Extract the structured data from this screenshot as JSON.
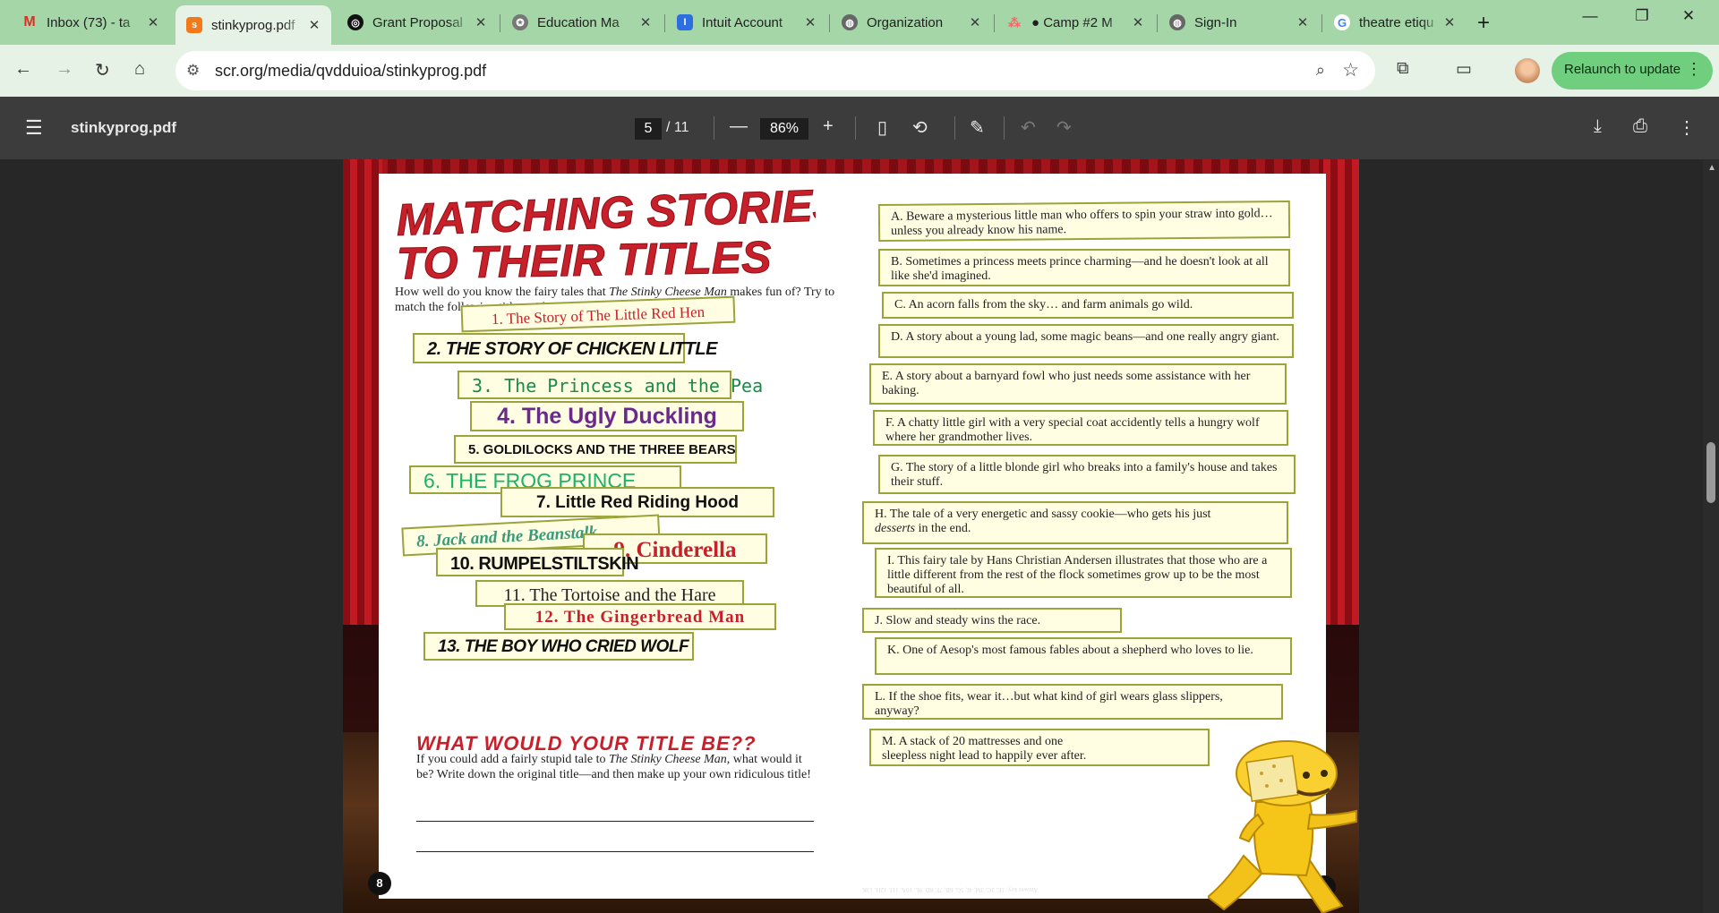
{
  "browser": {
    "tabs": [
      {
        "title": "Inbox (73) - ta",
        "icon": "gmail-icon",
        "color": "#d93025"
      },
      {
        "title": "stinkyprog.pdf",
        "icon": "pdf-site-icon",
        "color": "#f27a1a",
        "active": true
      },
      {
        "title": "Grant Proposal",
        "icon": "openai-icon",
        "color": "#111111"
      },
      {
        "title": "Education Ma",
        "icon": "seal-icon",
        "color": "#666666"
      },
      {
        "title": "Intuit Account",
        "icon": "intuit-icon",
        "color": "#2d6fe0"
      },
      {
        "title": "Organization",
        "icon": "globe-icon",
        "color": "#555555"
      },
      {
        "title": "● Camp #2 M",
        "icon": "asana-icon",
        "color": "#f06a6a"
      },
      {
        "title": "Sign-In",
        "icon": "globe-icon",
        "color": "#555555"
      },
      {
        "title": "theatre etiqu",
        "icon": "google-icon",
        "color": "#4285f4"
      }
    ],
    "url": "scr.org/media/qvdduioa/stinkyprog.pdf",
    "relaunch_label": "Relaunch to update"
  },
  "pdf": {
    "filename": "stinkyprog.pdf",
    "current_page": "5",
    "total_pages": "/ 11",
    "zoom": "86%"
  },
  "page_left": {
    "title_line1": "MATCHING STORIES",
    "title_line2": "TO THEIR TITLES",
    "intro_a": "How well do you know the fairy tales that ",
    "intro_book": "The Stinky Cheese Man",
    "intro_b": " makes fun of? Try to match the following titles with their description:",
    "titles": [
      "1. The Story of The Little Red Hen",
      "2. THE STORY OF CHICKEN LITTLE",
      "3. The Princess and the Pea",
      "4. The Ugly Duckling",
      "5. GOLDILOCKS AND THE THREE BEARS",
      "6. THE FROG PRINCE",
      "7. Little Red Riding Hood",
      "8. Jack and the Beanstalk",
      "9. Cinderella",
      "10. RUMPELSTILTSKIN",
      "11. The Tortoise and the Hare",
      "12. The Gingerbread Man",
      "13. THE BOY WHO CRIED WOLF"
    ],
    "subhead": "WHAT WOULD YOUR TITLE BE??",
    "sub_a": "If you could add a fairly stupid tale to ",
    "sub_book": "The Stinky Cheese Man",
    "sub_b": ", what would it be? Write down the original title—and then make up your own ridiculous title!",
    "page_number": "8"
  },
  "page_right": {
    "descriptions": [
      "A. Beware a mysterious little man who offers to spin your straw into gold…unless you already know his name.",
      "B. Sometimes a princess meets prince charming—and he doesn't look at all like she'd imagined.",
      "C. An acorn falls from the sky… and farm animals go wild.",
      "D. A story about a young lad, some magic beans—and one really angry giant.",
      "E. A story about a barnyard fowl who just needs some assistance with her baking.",
      "F. A chatty little girl with a very special coat accidently tells a hungry wolf where her grandmother lives.",
      "G. The story of a little blonde girl who breaks into a family's house and takes their stuff.",
      "H. The tale of a very energetic and sassy cookie—who gets his just",
      "I. This fairy tale by Hans Christian Andersen illustrates that those who are a little different from the rest of the flock sometimes grow up to be the most beautiful of all.",
      "J. Slow and steady wins the race.",
      "K. One of Aesop's most famous fables about a shepherd who loves to lie.",
      "L. If the shoe fits, wear it…but what kind of girl wears glass slippers, anyway?",
      "M. A stack of 20 mattresses and one sleepless night lead to happily ever after."
    ],
    "h_italic": "desserts",
    "h_tail": " in the end.",
    "answer_key": "Answer key: 1E, 2C, 3M, 4I, 5G, 6B, 7F, 8D, 9L, 10A, 11J, 12H, 13K",
    "page_number": "9"
  },
  "icons": {
    "back": "arrow-left-icon",
    "forward": "arrow-right-icon",
    "reload": "reload-icon",
    "home": "home-icon",
    "menu": "hamburger-icon",
    "download": "download-icon",
    "print": "print-icon"
  }
}
